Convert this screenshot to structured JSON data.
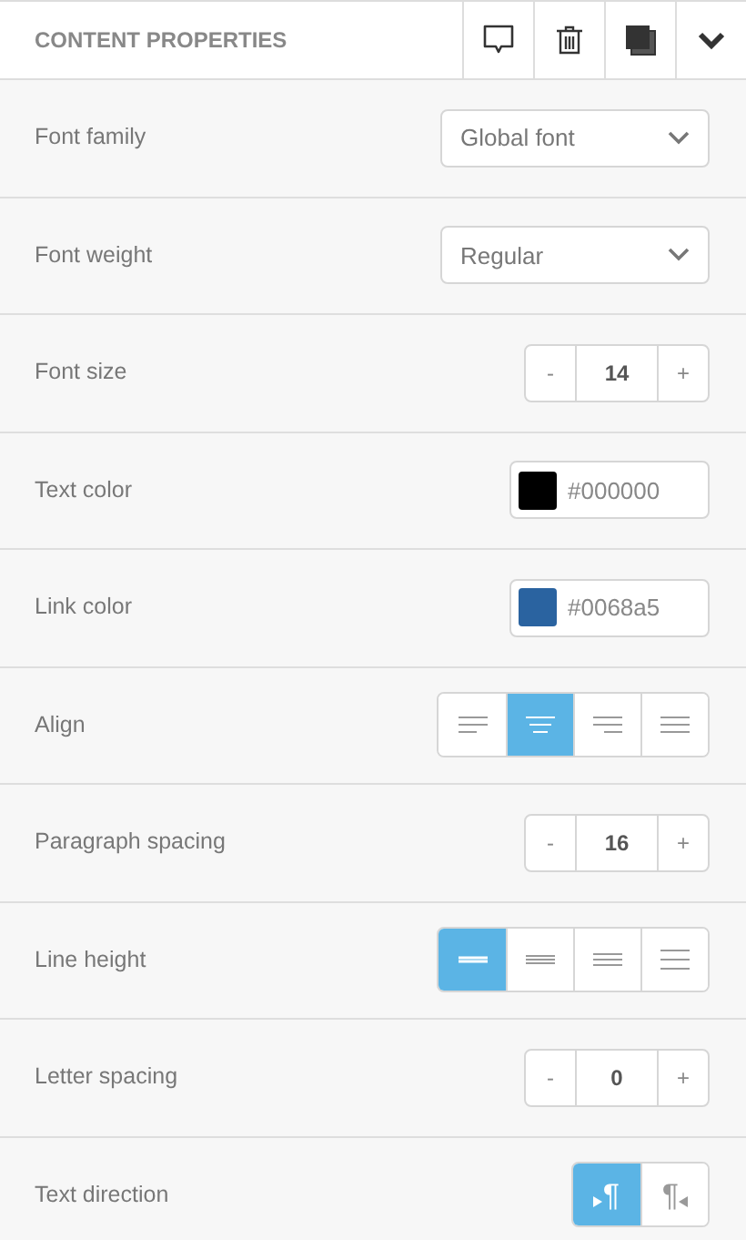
{
  "header": {
    "title": "CONTENT PROPERTIES",
    "actions": [
      {
        "kind": "comment"
      },
      {
        "kind": "delete"
      },
      {
        "kind": "duplicate"
      },
      {
        "kind": "collapse"
      }
    ]
  },
  "rows": [
    {
      "kind": "select",
      "label": "Font family",
      "value": "Global font"
    },
    {
      "kind": "select",
      "label": "Font weight",
      "value": "Regular"
    },
    {
      "kind": "stepper",
      "label": "Font size",
      "minus": "-",
      "value": "14",
      "plus": "+"
    },
    {
      "kind": "color",
      "label": "Text color",
      "value": "#000000",
      "color": "#000000"
    },
    {
      "kind": "color",
      "label": "Link color",
      "value": "#0068a5",
      "color": "#2a63a0"
    },
    {
      "kind": "segmented",
      "label": "Align",
      "options": [
        {
          "kind": "align-left",
          "selected": false
        },
        {
          "kind": "align-center",
          "selected": true
        },
        {
          "kind": "align-right",
          "selected": false
        },
        {
          "kind": "justify",
          "selected": false
        }
      ]
    },
    {
      "kind": "stepper",
      "label": "Paragraph spacing",
      "minus": "-",
      "value": "16",
      "plus": "+"
    },
    {
      "kind": "segmented",
      "label": "Line height",
      "options": [
        {
          "kind": "lh-1",
          "selected": true
        },
        {
          "kind": "lh-2",
          "selected": false
        },
        {
          "kind": "lh-3",
          "selected": false
        },
        {
          "kind": "lh-4",
          "selected": false
        }
      ]
    },
    {
      "kind": "stepper",
      "label": "Letter spacing",
      "minus": "-",
      "value": "0",
      "plus": "+"
    },
    {
      "kind": "segmented",
      "label": "Text direction",
      "options": [
        {
          "kind": "ltr",
          "label": "¶",
          "selected": true
        },
        {
          "kind": "rtl",
          "label": "¶",
          "selected": false
        }
      ]
    }
  ]
}
